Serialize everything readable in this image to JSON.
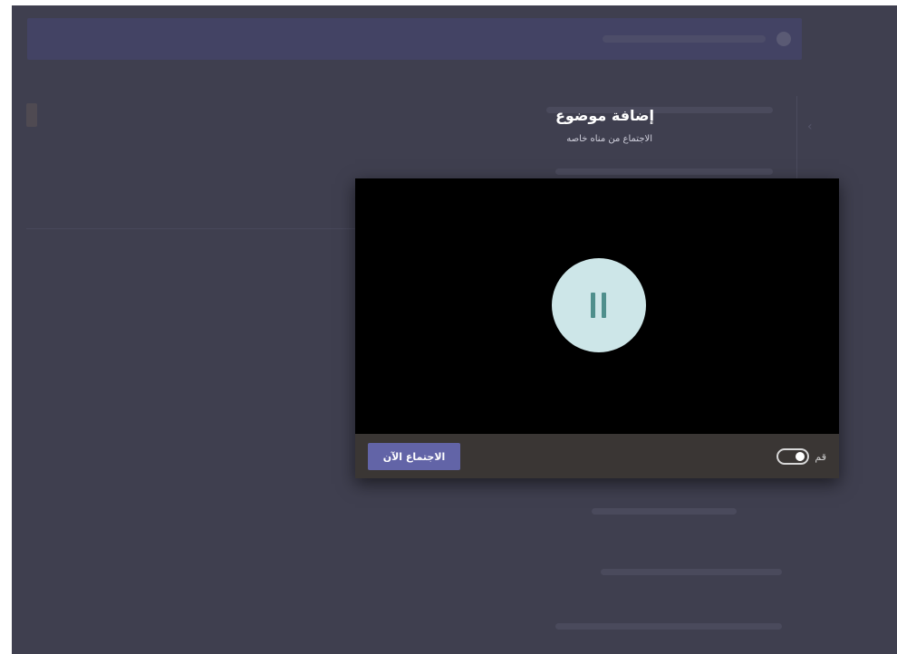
{
  "dialog": {
    "title": "إضافة موضوع",
    "subtitle": "الاجتماع من مناه خاصه"
  },
  "player": {
    "state": "playing",
    "pause_icon": "pause-icon",
    "listen_now_label": "الاجتماع الآن",
    "toggle_label": "قم",
    "toggle_on": true
  },
  "colors": {
    "backdrop": "#3f3f4f",
    "video_bg": "#000000",
    "control_bar": "#3a3634",
    "accent_button": "#6264a7",
    "pause_circle": "#cde6e8",
    "pause_bars": "#4f8f8c"
  }
}
